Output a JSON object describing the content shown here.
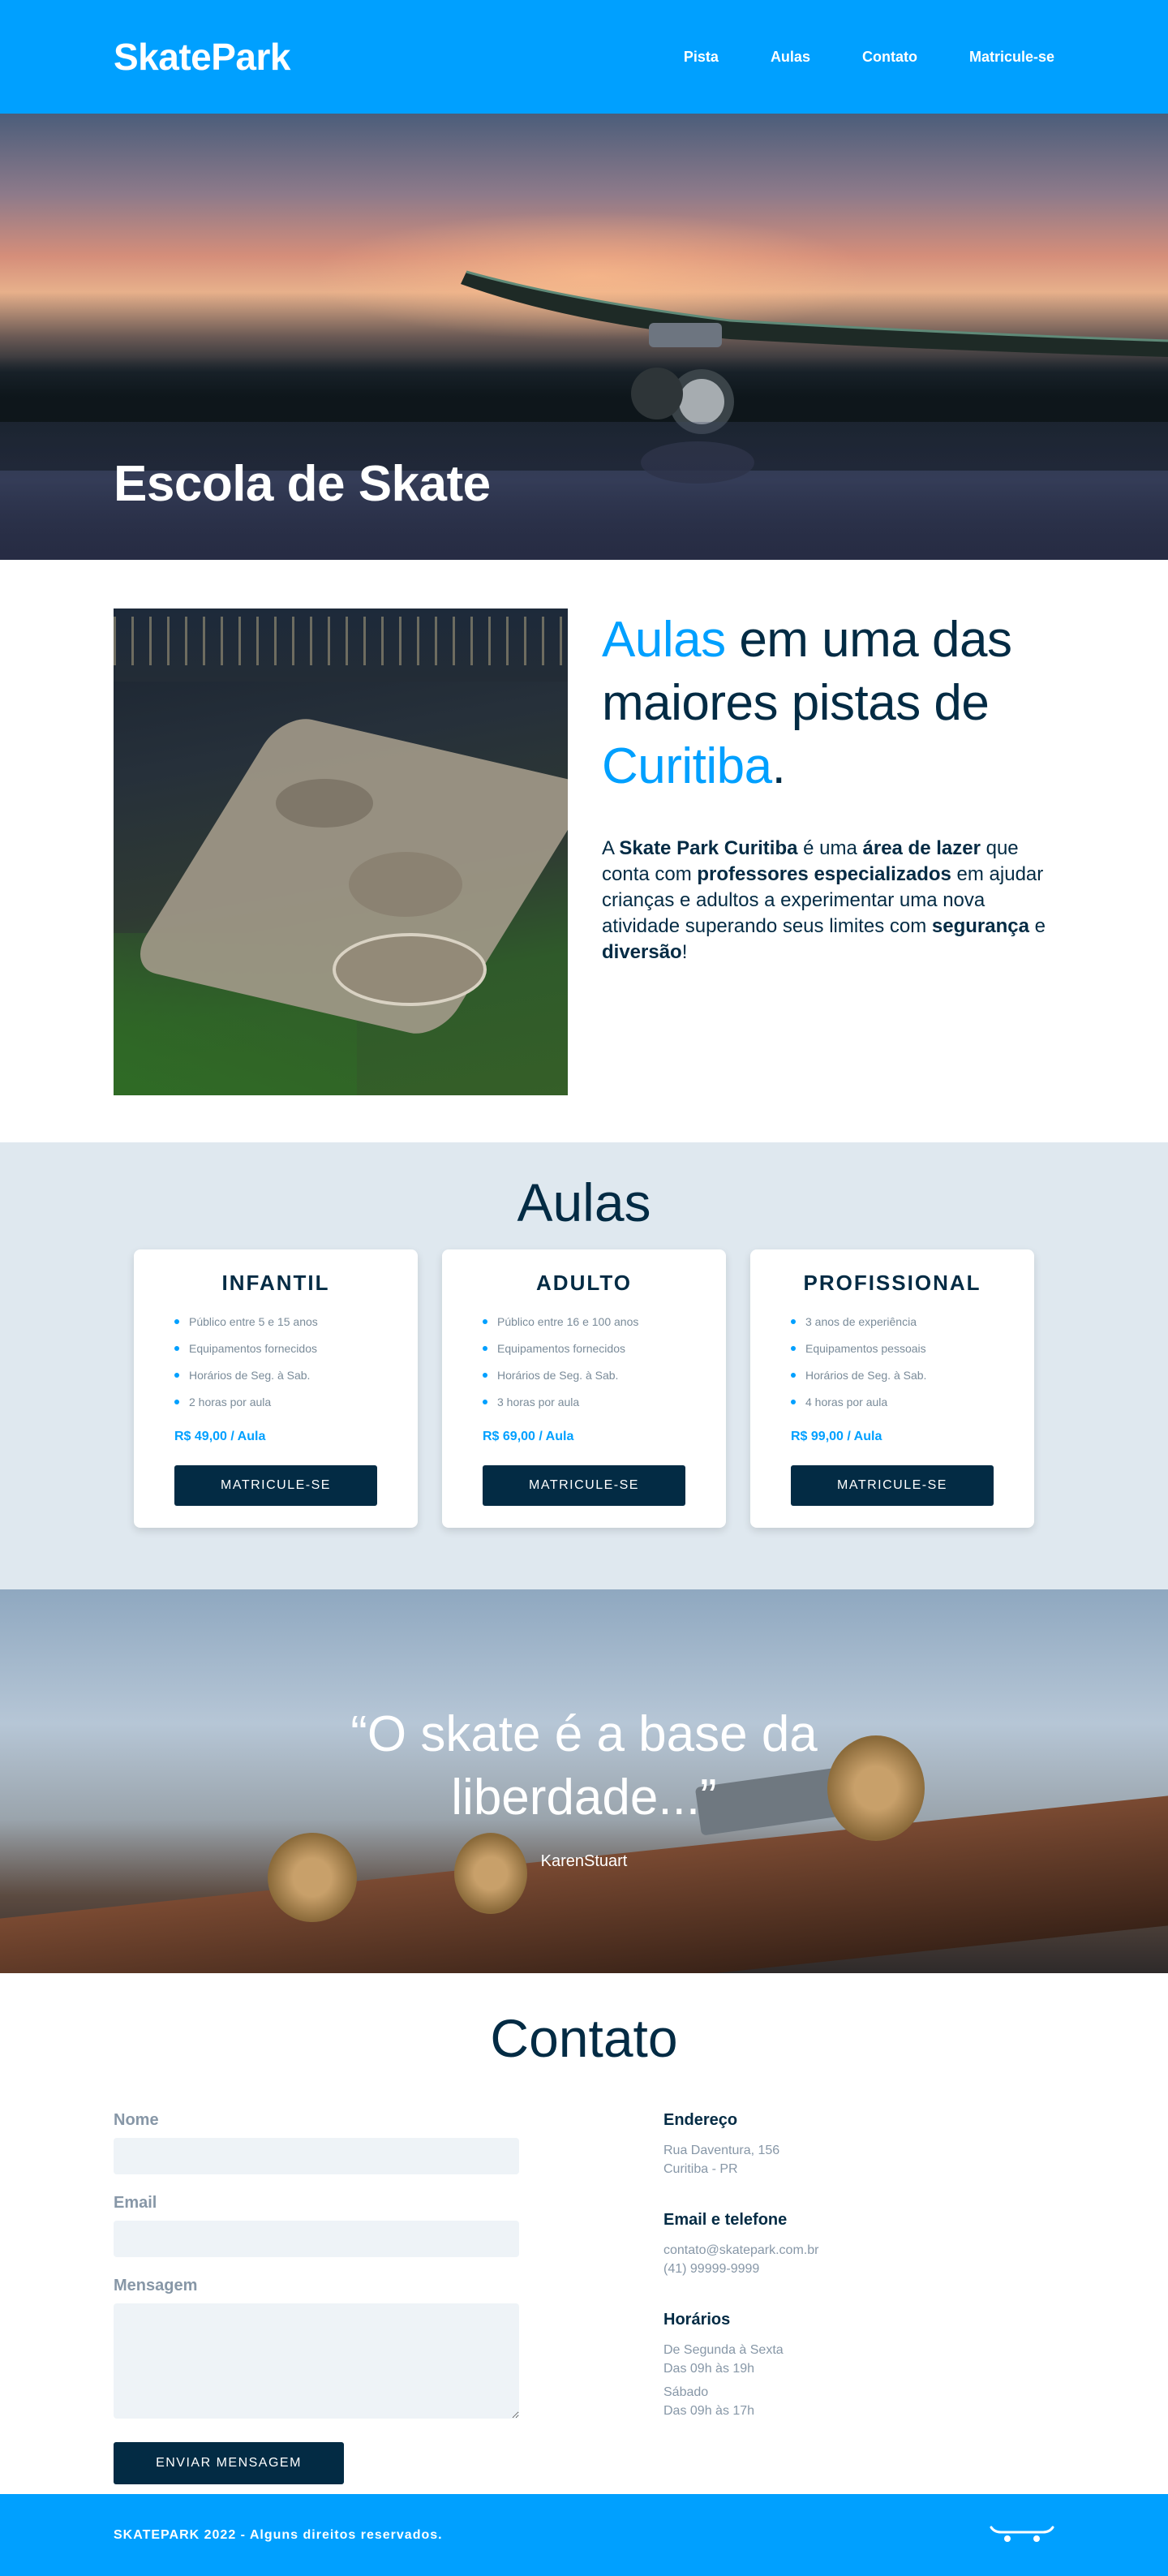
{
  "header": {
    "logo": "SkatePark",
    "nav": [
      {
        "label": "Pista"
      },
      {
        "label": "Aulas"
      },
      {
        "label": "Contato"
      },
      {
        "label": "Matricule-se"
      }
    ]
  },
  "hero": {
    "title": "Escola de Skate"
  },
  "about": {
    "heading_accent_1": "Aulas",
    "heading_mid": " em uma das maiores pistas de ",
    "heading_accent_2": "Curitiba",
    "heading_end": ".",
    "desc": {
      "t1": "A ",
      "b1": "Skate Park Curitiba",
      "t2": " é uma ",
      "b2": "área de lazer",
      "t3": " que conta com ",
      "b3": "professores especializados",
      "t4": " em ajudar crianças e adultos a experimentar uma nova atividade superando seus limites com ",
      "b4": "segurança",
      "t5": " e ",
      "b5": "diversão",
      "t6": "!"
    }
  },
  "classes": {
    "title": "Aulas",
    "cards": [
      {
        "title": "INFANTIL",
        "items": [
          "Público entre 5 e 15 anos",
          "Equipamentos fornecidos",
          "Horários de Seg. à Sab.",
          "2 horas por aula"
        ],
        "price": "R$ 49,00 / Aula",
        "button": "MATRICULE-SE"
      },
      {
        "title": "ADULTO",
        "items": [
          "Público entre 16 e 100 anos",
          "Equipamentos fornecidos",
          "Horários de Seg. à Sab.",
          "3 horas por aula"
        ],
        "price": "R$ 69,00 / Aula",
        "button": "MATRICULE-SE"
      },
      {
        "title": "PROFISSIONAL",
        "items": [
          "3 anos de experiência",
          "Equipamentos pessoais",
          "Horários de Seg. à Sab.",
          "4 horas por aula"
        ],
        "price": "R$ 99,00 / Aula",
        "button": "MATRICULE-SE"
      }
    ]
  },
  "quote": {
    "text": "“O skate é a base da liberdade...”",
    "author": "KarenStuart"
  },
  "contact": {
    "title": "Contato",
    "form": {
      "name_label": "Nome",
      "email_label": "Email",
      "message_label": "Mensagem",
      "send_button": "ENVIAR MENSAGEM"
    },
    "address": {
      "title": "Endereço",
      "line1": "Rua Daventura, 156",
      "line2": "Curitiba - PR"
    },
    "email_phone": {
      "title": "Email e telefone",
      "email": "contato@skatepark.com.br",
      "phone": "(41) 99999-9999"
    },
    "hours": {
      "title": "Horários",
      "line1": "De Segunda à Sexta",
      "line2": "Das 09h às 19h",
      "line3": "Sábado",
      "line4": "Das 09h às 17h"
    }
  },
  "footer": {
    "text": "SKATEPARK 2022 - Alguns direitos reservados.",
    "icon": "skateboard-icon"
  },
  "colors": {
    "primary": "#00a0ff",
    "dark": "#032b44",
    "muted": "#8797a7",
    "section_bg": "#dfe8ef"
  }
}
